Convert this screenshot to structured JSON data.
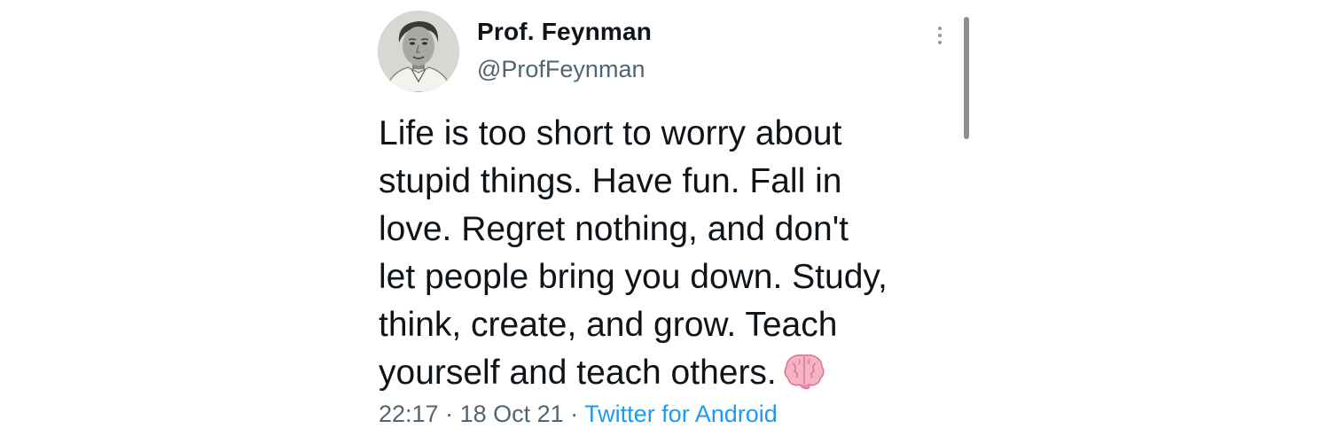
{
  "author": {
    "display_name": "Prof. Feynman",
    "handle": "@ProfFeynman"
  },
  "tweet": {
    "lines": [
      "Life is too short to worry about",
      "stupid things. Have fun. Fall in",
      "love. Regret nothing, and don't",
      "let people bring you down. Study,",
      "think, create, and grow. Teach",
      "yourself and teach others."
    ],
    "emoji": "brain-emoji"
  },
  "meta": {
    "time": "22:17",
    "separator": " · ",
    "date": "18 Oct 21",
    "source": "Twitter for Android"
  },
  "colors": {
    "text_primary": "#0f1419",
    "text_secondary": "#536471",
    "link": "#1d9bf0",
    "emoji_pink": "#f4a7b9"
  },
  "icons": {
    "more": "more-vertical-icon",
    "avatar": "avatar-photo"
  }
}
